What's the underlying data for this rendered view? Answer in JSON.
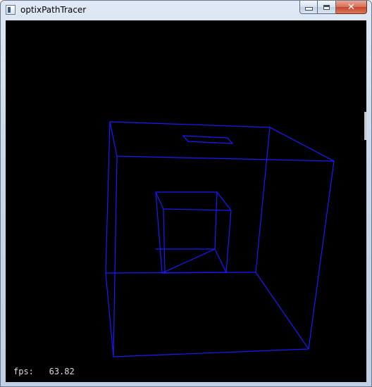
{
  "window": {
    "title": "optixPathTracer",
    "icon": "app-window-icon",
    "controls": {
      "minimize_icon": "minimize-icon",
      "maximize_icon": "maximize-icon",
      "close_glyph": "✕"
    }
  },
  "viewport": {
    "background": "#000000",
    "wire_color": "#1a1aff",
    "fps_label": "fps:",
    "fps_value": "63.82"
  }
}
